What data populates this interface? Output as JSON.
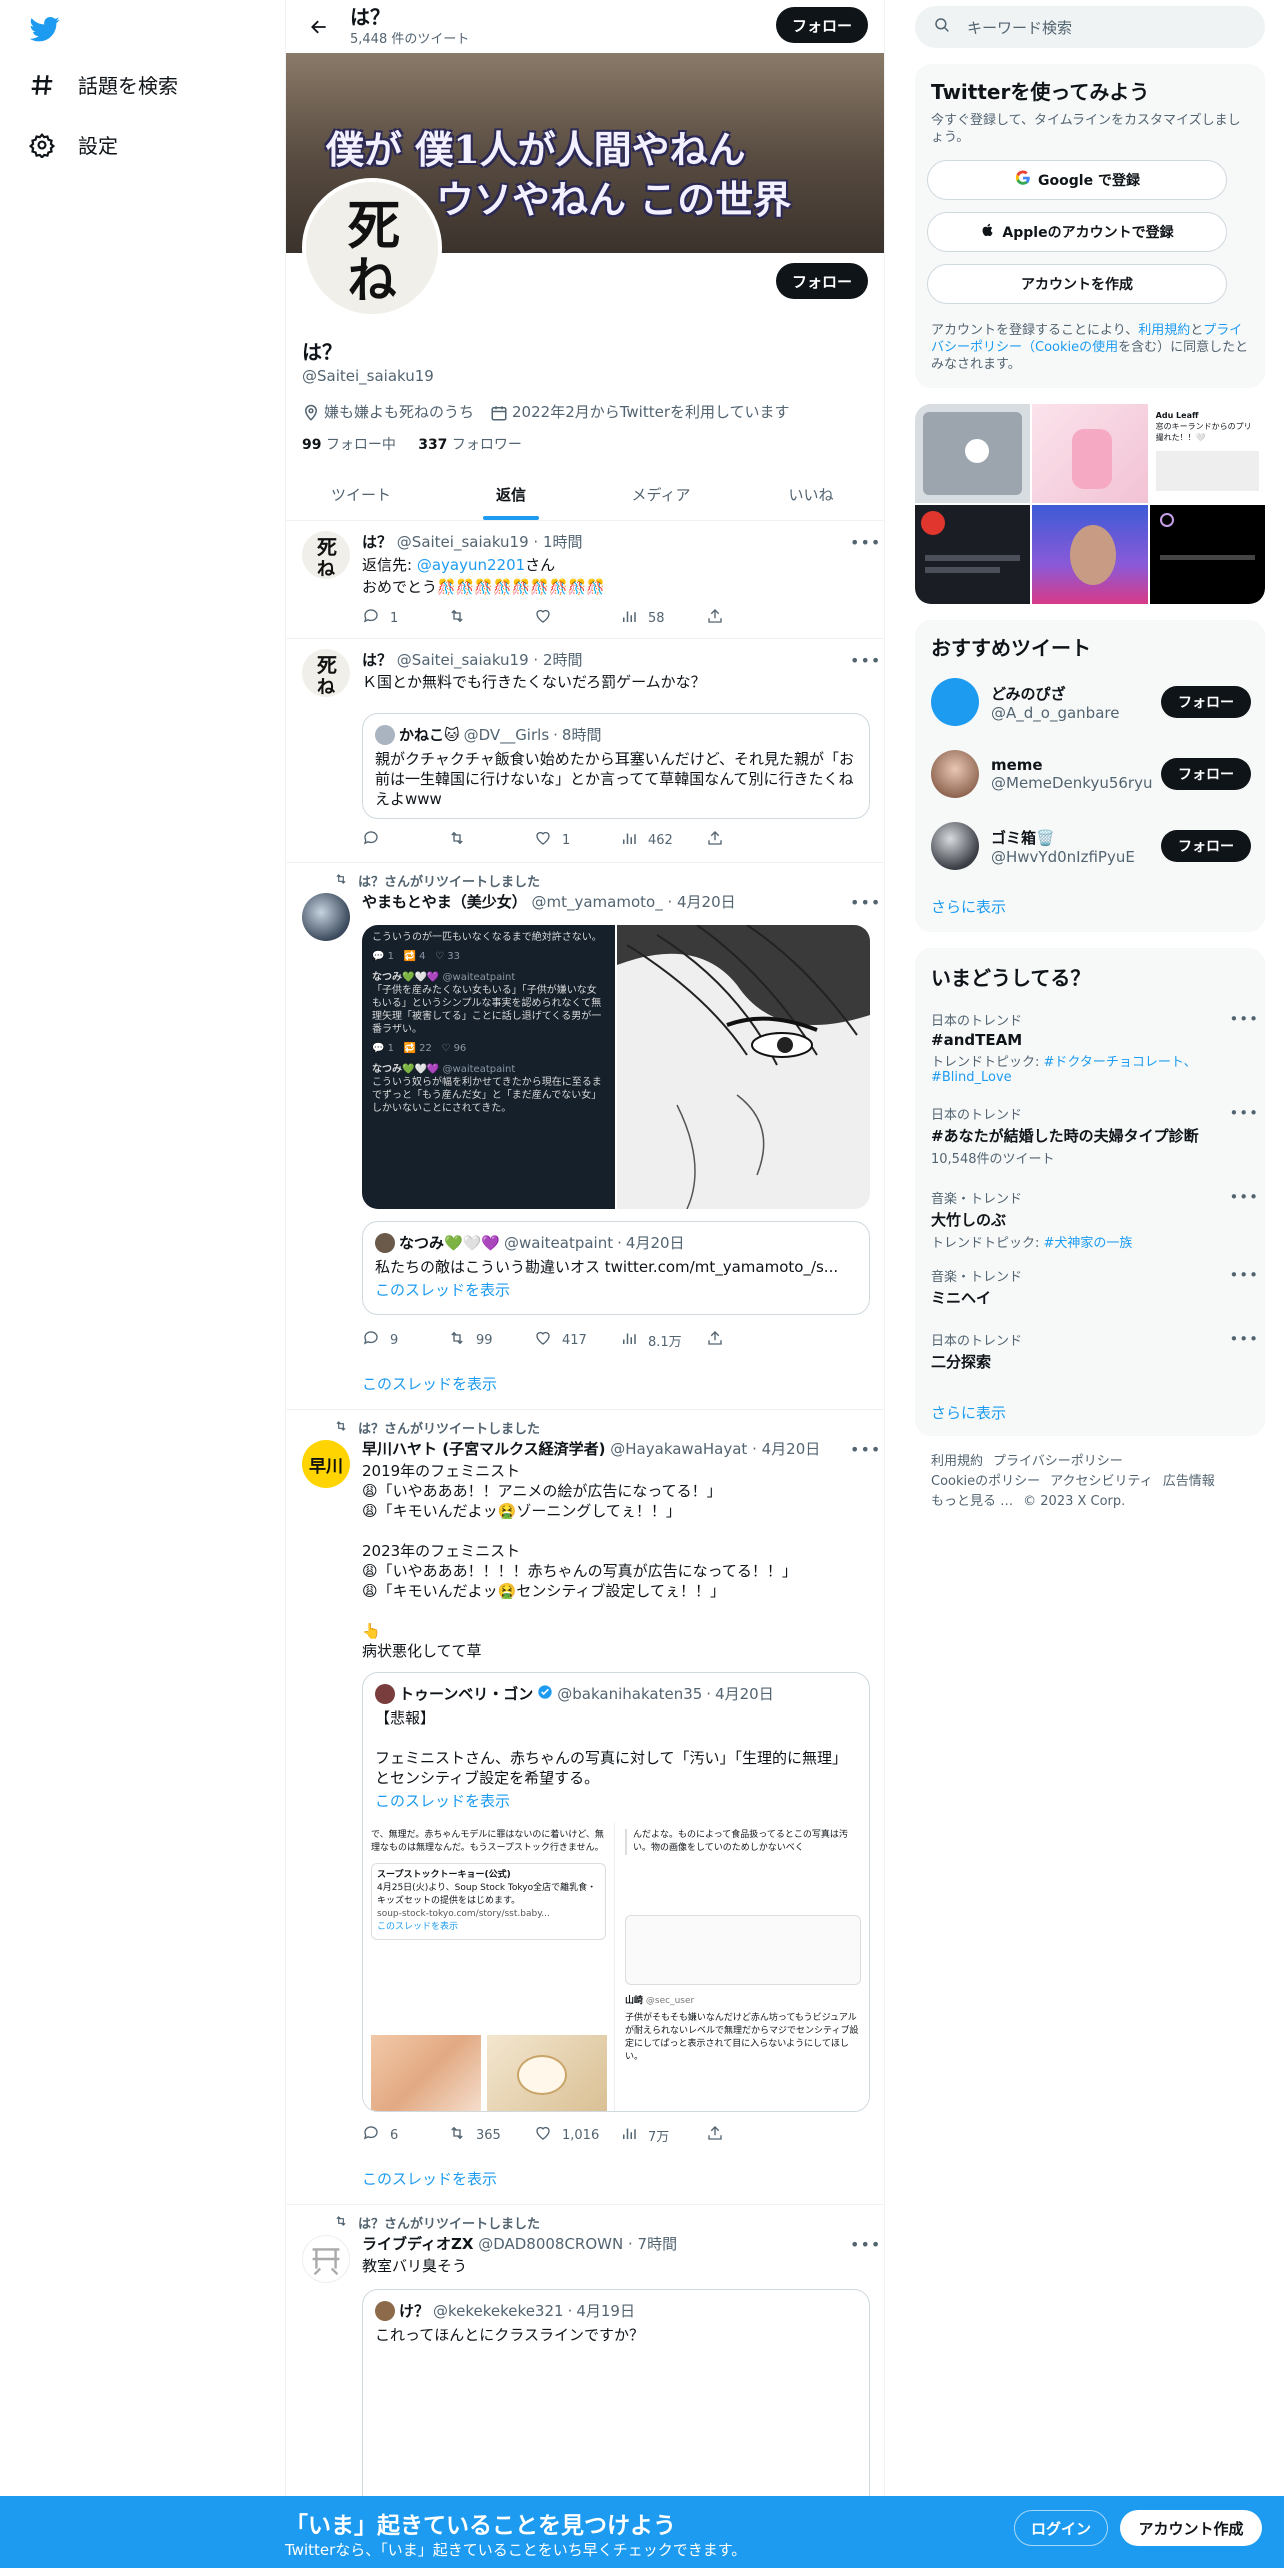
{
  "nav": {
    "explore": "話題を検索",
    "settings": "設定"
  },
  "profile": {
    "header_name": "は？",
    "tweet_count": "5,448 件のツイート",
    "follow": "フォロー",
    "banner_line1": "僕が 僕1人が人間やねん",
    "banner_line2": "ウソやねん この世界",
    "pfp_glyph1": "死",
    "pfp_glyph2": "ね",
    "name": "は？",
    "handle": "@Saitei_saiaku19",
    "location": "嫌も嫌よも死ねのうち",
    "joined": "2022年2月からTwitterを利用しています",
    "following_count": "99",
    "following_label": "フォロー中",
    "followers_count": "337",
    "followers_label": "フォロワー"
  },
  "tabs": [
    "ツイート",
    "返信",
    "メディア",
    "いいね"
  ],
  "tweets": [
    {
      "name": "は？",
      "handle": "@Saitei_saiaku19",
      "time": "1時間",
      "reply_to_prefix": "返信先: ",
      "reply_to": "@ayayun2201",
      "reply_to_suffix": "さん",
      "text": "おめでとう🎊🎊🎊🎊🎊🎊🎊🎊🎊",
      "replies": "1",
      "retweets": "",
      "likes": "",
      "views": "58"
    },
    {
      "name": "は？",
      "handle": "@Saitei_saiaku19",
      "time": "2時間",
      "text": "Ｋ国とか無料でも行きたくないだろ罰ゲームかな？",
      "quote_name": "かねこ🐱",
      "quote_handle": "@DV__Girls",
      "quote_time": "8時間",
      "quote_text": "親がクチャクチャ飯食い始めたから耳塞いんだけど、それ見た親が「お前は一生韓国に行けないな」とか言ってて草韓国なんて別に行きたくねえよwww",
      "replies": "",
      "retweets": "",
      "likes": "1",
      "views": "462"
    },
    {
      "rt_label": "は？さんがリツイートしました",
      "name": "やまもとやま（美少女）",
      "handle": "@mt_yamamoto_",
      "time": "4月20日",
      "img_user": "なつみ💚🤍💜",
      "img_handle": "@waiteatpaint",
      "img_text1": "こういうのが一匹もいなくなるまで絶対許さない。",
      "img_text2": "「子供を産みたくない女もいる」「子供が嫌いな女もいる」というシンプルな事実を認められなくて無理矢理「被害してる」ことに話し退げてくる男が一番ラザい。",
      "img_text3": "こういう奴らが幅を利かせてきたから現在に至るまでずっと「もう産んだ女」と「まだ産んでない女」しかいないことにされてきた。",
      "quote_name": "なつみ💚🤍💜",
      "quote_handle": "@waiteatpaint",
      "quote_time": "4月20日",
      "quote_text": "私たちの敵はこういう勘違いオス twitter.com/mt_yamamoto_/s...",
      "quote_thread": "このスレッドを表示",
      "replies": "9",
      "retweets": "99",
      "likes": "417",
      "views": "8.1万",
      "show_thread": "このスレッドを表示"
    },
    {
      "rt_label": "は？さんがリツイートしました",
      "name": "早川ハヤト (子宮マルクス経済学者)",
      "handle": "@HayakawaHayat",
      "time": "4月20日",
      "avatar_text": "早川",
      "lines": [
        "2019年のフェミニスト",
        "😩「いやあああ！！アニメの絵が広告になってる！」",
        "😩「キモいんだよッ🤮ゾーニングしてぇ！！」",
        "",
        "2023年のフェミニスト",
        "😩「いやあああ！！！！赤ちゃんの写真が広告になってる！！」",
        "😩「キモいんだよッ🤮センシティブ設定してぇ！！」",
        "",
        "👆",
        "病状悪化してて草"
      ],
      "quote_name": "トゥーンベリ・ゴン",
      "quote_handle": "@bakanihakaten35",
      "quote_time": "4月20日",
      "quote_lines": [
        "【悲報】",
        "",
        "フェミニストさん、赤ちゃんの写真に対して「汚い」「生理的に無理」とセンシティブ設定を希望する。"
      ],
      "quote_thread": "このスレッドを表示",
      "img_left_text": "で、無理だ。赤ちゃんモデルに罪はないのに着いけど、無理なものは無理なんだ。もうスープストック行きません。",
      "img_left_card_title": "スープストックトーキョー(公式)",
      "img_left_card_text": "4月25日(火)より、Soup Stock Tokyo全店で離乳食・キッズセットの提供をはじめます。",
      "img_left_link": "soup-stock-tokyo.com/story/sst.baby...",
      "img_right_text": "んだよな。ものによって食品扱ってるとこの写真は汚い。物の画像をしていのためしかないべく",
      "img_right_user": "山崎",
      "img_right_handle": "@sec_user",
      "img_right_text2": "子供がそもそも嫌いなんだけど赤ん坊ってもうビジュアルが耐えられないレベルで無理だからマジでセンシティブ設定にしてぱっと表示されて目に入らないようにしてほしい。",
      "replies": "6",
      "retweets": "365",
      "likes": "1,016",
      "views": "7万",
      "show_thread": "このスレッドを表示"
    },
    {
      "rt_label": "は？さんがリツイートしました",
      "name": "ライブディオZX",
      "handle": "@DAD8008CROWN",
      "time": "7時間",
      "text": "教室バリ臭そう",
      "quote_name": "け？",
      "quote_handle": "@kekekekeke321",
      "quote_time": "4月19日",
      "quote_text": "これってほんとにクラスラインですか？"
    }
  ],
  "right": {
    "search_placeholder": "キーワード検索",
    "join_title": "Twitterを使ってみよう",
    "join_sub": "今すぐ登録して、タイムラインをカスタマイズしましょう。",
    "google_btn": "Google で登録",
    "apple_btn": "Appleのアカウントで登録",
    "create_btn": "アカウントを作成",
    "terms_1": "アカウントを登録することにより、",
    "terms_link1": "利用規約",
    "terms_2": "と",
    "terms_link2": "プライバシーポリシー（Cookieの使用",
    "terms_3": "を含む）に同意したとみなされます。",
    "recommend_title": "おすすめツイート",
    "suggestions": [
      {
        "name": "どみのぴざ",
        "handle": "@A_d_o_ganbare",
        "color": "#1d9bf0"
      },
      {
        "name": "meme",
        "handle": "@MemeDenkyu56ryu",
        "color": "#c49a86"
      },
      {
        "name": "ゴミ箱🗑️",
        "handle": "@HwvYd0nIzfiPyuE",
        "color": "#555c66"
      }
    ],
    "show_more": "さらに表示",
    "trends_title": "いまどうしてる？",
    "trends": [
      {
        "ctx": "日本のトレンド",
        "name": "#andTEAM",
        "meta_prefix": "トレンドトピック: ",
        "meta_links": "#ドクターチョコレート、#Blind_Love"
      },
      {
        "ctx": "日本のトレンド",
        "name": "#あなたが結婚した時の夫婦タイプ診断",
        "meta": "10,548件のツイート"
      },
      {
        "ctx": "音楽・トレンド",
        "name": "大竹しのぶ",
        "meta_prefix": "トレンドトピック: ",
        "meta_links": "#犬神家の一族"
      },
      {
        "ctx": "音楽・トレンド",
        "name": "ミニヘイ"
      },
      {
        "ctx": "日本のトレンド",
        "name": "二分探索"
      }
    ],
    "footer": [
      "利用規約",
      "プライバシーポリシー",
      "Cookieのポリシー",
      "アクセシビリティ",
      "広告情報",
      "もっと見る …",
      "© 2023 X Corp."
    ],
    "media_labels": {
      "ph_user": "Adu Leaff",
      "ph_text": "窓のキーランドからのプリ撮れた！！🤍"
    }
  },
  "bottom": {
    "title": "「いま」起きていることを見つけよう",
    "sub": "Twitterなら、「いま」起きていることをいち早くチェックできます。",
    "login": "ログイン",
    "signup": "アカウント作成"
  },
  "colors": {
    "accent": "#1d9bf0",
    "text": "#0f1419",
    "muted": "#536471"
  }
}
